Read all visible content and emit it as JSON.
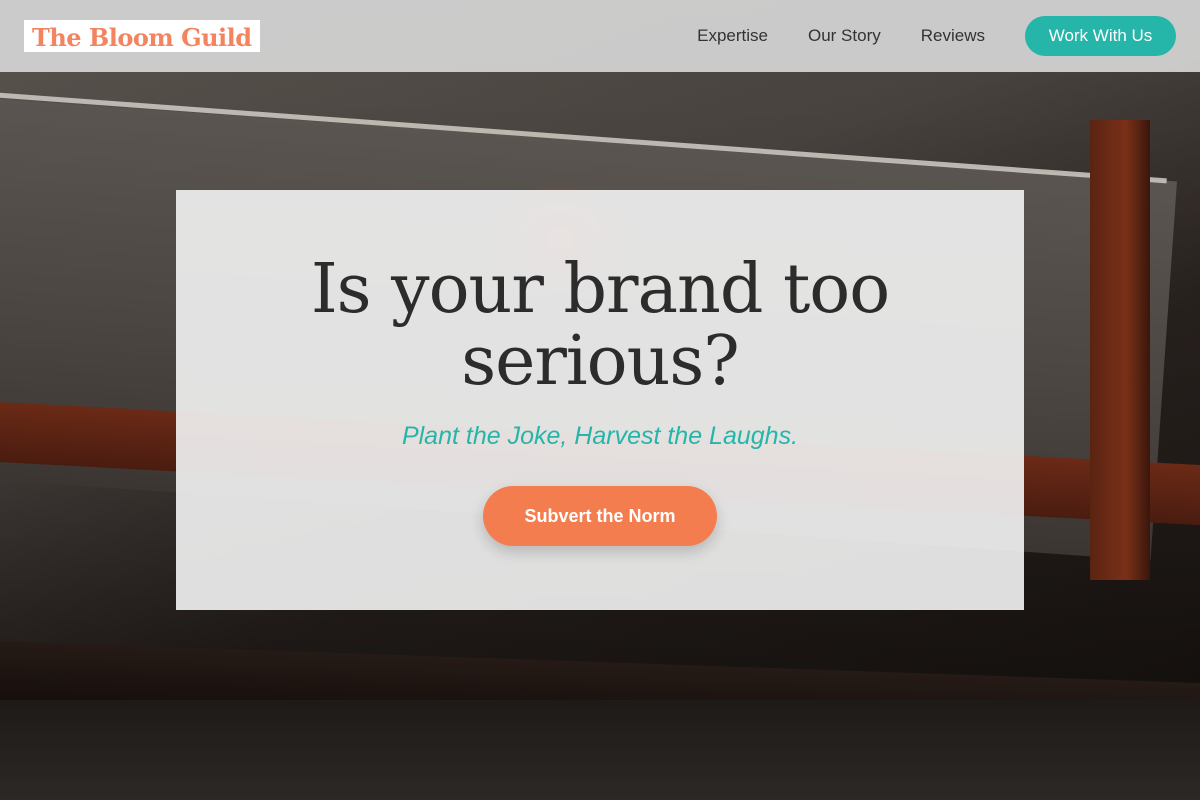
{
  "brand": {
    "name": "The Bloom Guild",
    "color": "#f4845f"
  },
  "nav": {
    "links": [
      "Expertise",
      "Our Story",
      "Reviews"
    ],
    "cta_label": "Work With Us",
    "cta_color": "#26b5a9"
  },
  "hero": {
    "title": "Is your brand too serious?",
    "subtitle": "Plant the Joke, Harvest the Laughs.",
    "cta_label": "Subvert the Norm",
    "cta_color": "#f47d4f",
    "background_image": "concrete-ledge-photo"
  }
}
